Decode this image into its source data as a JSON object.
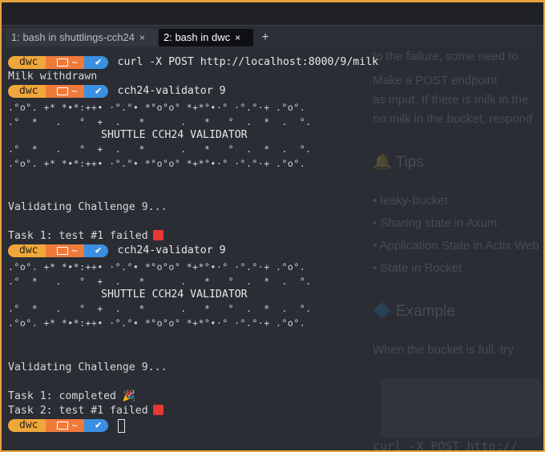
{
  "tabs": [
    {
      "label": "1: bash in shuttlings-cch24",
      "close": "×"
    },
    {
      "label": "2: bash in dwc",
      "close": "×"
    }
  ],
  "new_tab": "+",
  "prompt": {
    "user": "dwc",
    "dir": "~",
    "status": "✔"
  },
  "ghost_page": {
    "line1": "to the failure, some need to",
    "line2": "Make a POST endpoint",
    "line3": "as input. If there is milk in the",
    "line4": "no milk in the bucket, respond",
    "tips_heading": "🔔 Tips",
    "tip1": "• leaky-bucket",
    "tip2": "• Sharing state in Axum",
    "tip3": "• Application State in Actix Web",
    "tip4": "• State in Rocket",
    "example_heading": "🔷 Example",
    "example_text": "When the bucket is full, try",
    "code_bottom": "curl -X POST http://"
  },
  "terminal": {
    "cmd1": "curl -X POST http://localhost:8000/9/milk",
    "out1": "Milk withdrawn",
    "cmd2": "cch24-validator 9",
    "banner_top": ".°o°. +* *•*:++• ·°.°• *°o°o° *+*°•·° ·°.°·+ .°o°.",
    "banner_upper": ".°  *   .   °  +  .   *      .   *   °  .  *  .  °.",
    "banner_title": "SHUTTLE CCH24 VALIDATOR",
    "banner_lower": ".°  *   .   °  +  .   *      .   *   °  .  *  .  °.",
    "banner_bottom": ".°o°. +* *•*:++• ·°.°• *°o°o° *+*°•·° ·°.°·+ .°o°.",
    "validating": "Validating Challenge 9...",
    "task1_failed": "Task 1: test #1 failed",
    "cmd3": "cch24-validator 9",
    "task1_completed": "Task 1: completed 🎉",
    "task2_failed": "Task 2: test #1 failed"
  }
}
